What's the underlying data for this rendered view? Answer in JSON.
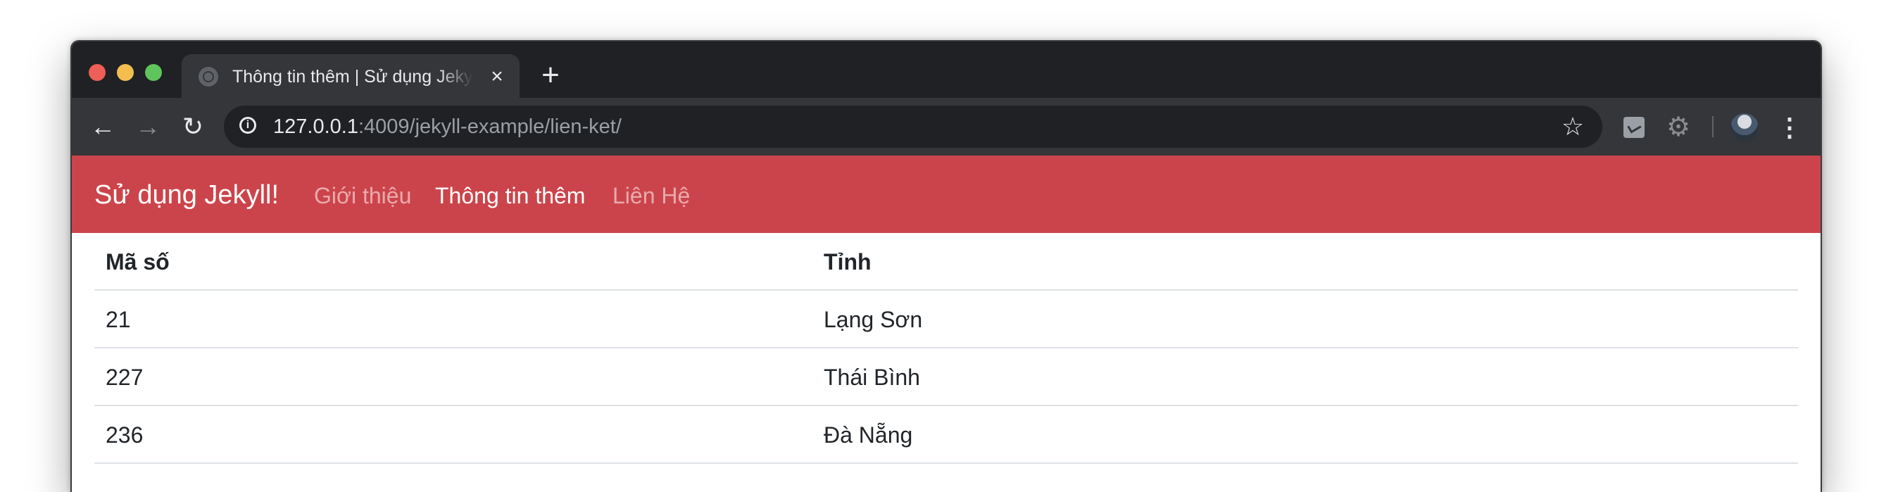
{
  "browser": {
    "tab": {
      "title": "Thông tin thêm | Sử dụng Jekyll!",
      "close_icon": "×"
    },
    "new_tab_icon": "+",
    "url_host": "127.0.0.1",
    "url_rest": ":4009/jekyll-example/lien-ket/",
    "icons": {
      "back": "←",
      "forward": "→",
      "reload": "↻",
      "info": "i",
      "star": "☆",
      "extension_puzzle": "⚙",
      "menu": "⋮"
    }
  },
  "navbar": {
    "brand": "Sử dụng Jekyll!",
    "links": [
      {
        "label": "Giới thiệu",
        "active": false
      },
      {
        "label": "Thông tin thêm",
        "active": true
      },
      {
        "label": "Liên Hệ",
        "active": false
      }
    ],
    "color": "#cc444b"
  },
  "table": {
    "headers": [
      "Mã số",
      "Tỉnh"
    ],
    "rows": [
      [
        "21",
        "Lạng Sơn"
      ],
      [
        "227",
        "Thái Bình"
      ],
      [
        "236",
        "Đà Nẵng"
      ]
    ]
  }
}
